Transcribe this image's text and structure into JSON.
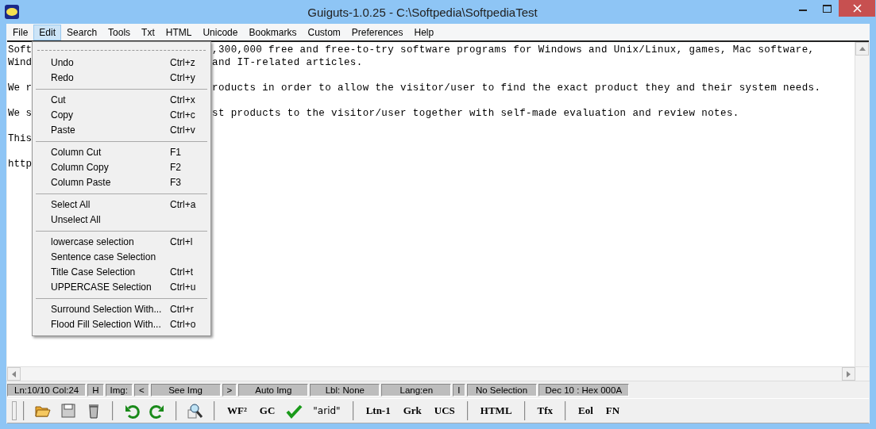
{
  "window": {
    "title": "Guiguts-1.0.25 - C:\\Softpedia\\SoftpediaTest"
  },
  "menu_bar": [
    {
      "label": "File",
      "selected": false
    },
    {
      "label": "Edit",
      "selected": true
    },
    {
      "label": "Search",
      "selected": false
    },
    {
      "label": "Tools",
      "selected": false
    },
    {
      "label": "Txt",
      "selected": false
    },
    {
      "label": "HTML",
      "selected": false
    },
    {
      "label": "Unicode",
      "selected": false
    },
    {
      "label": "Bookmarks",
      "selected": false
    },
    {
      "label": "Custom",
      "selected": false
    },
    {
      "label": "Preferences",
      "selected": false
    },
    {
      "label": "Help",
      "selected": false
    }
  ],
  "editor": {
    "paragraphs": [
      {
        "lines": [
          {
            "left": "Soft",
            "right": ",300,000 free and free-to-try software programs for Windows and Unix/Linux, games, Mac software,"
          },
          {
            "left": "Wind",
            "right": "and IT-related articles."
          }
        ]
      },
      {
        "lines": [
          {
            "left": "We r",
            "right": "roducts in order to allow the visitor/user to find the exact product they and their system needs."
          }
        ]
      },
      {
        "lines": [
          {
            "left": "We s",
            "right": "st products to the visitor/user together with self-made evaluation and review notes."
          }
        ]
      },
      {
        "lines": [
          {
            "left": "This"
          }
        ]
      },
      {
        "lines": [
          {
            "left": "http"
          }
        ]
      }
    ]
  },
  "edit_menu": {
    "groups": [
      [
        {
          "label": "Undo",
          "shortcut": "Ctrl+z"
        },
        {
          "label": "Redo",
          "shortcut": "Ctrl+y"
        }
      ],
      [
        {
          "label": "Cut",
          "shortcut": "Ctrl+x"
        },
        {
          "label": "Copy",
          "shortcut": "Ctrl+c"
        },
        {
          "label": "Paste",
          "shortcut": "Ctrl+v"
        }
      ],
      [
        {
          "label": "Column Cut",
          "shortcut": "F1"
        },
        {
          "label": "Column Copy",
          "shortcut": "F2"
        },
        {
          "label": "Column Paste",
          "shortcut": "F3"
        }
      ],
      [
        {
          "label": "Select All",
          "shortcut": "Ctrl+a"
        },
        {
          "label": "Unselect All"
        }
      ],
      [
        {
          "label": "lowercase selection",
          "shortcut": "Ctrl+l"
        },
        {
          "label": "Sentence case Selection"
        },
        {
          "label": "Title Case Selection",
          "shortcut": "Ctrl+t"
        },
        {
          "label": "UPPERCASE Selection",
          "shortcut": "Ctrl+u"
        }
      ],
      [
        {
          "label": "Surround Selection With...",
          "shortcut": "Ctrl+r"
        },
        {
          "label": "Flood Fill Selection With...",
          "shortcut": "Ctrl+o"
        }
      ]
    ]
  },
  "status_bar": [
    "Ln:10/10 Col:24",
    "H",
    "Img:",
    "<",
    "See Img",
    ">",
    "Auto Img",
    "Lbl: None",
    "Lang:en",
    "I",
    "No Selection",
    "Dec 10 : Hex 000A"
  ],
  "toolbar": {
    "groups": [
      [
        {
          "kind": "folder"
        },
        {
          "kind": "floppy"
        },
        {
          "kind": "trash"
        }
      ],
      [
        {
          "kind": "undo"
        },
        {
          "kind": "redo"
        }
      ],
      [
        {
          "kind": "magnifier"
        }
      ],
      [
        {
          "kind": "label",
          "label": "WF²"
        },
        {
          "kind": "label",
          "label": "GC"
        },
        {
          "kind": "check"
        },
        {
          "kind": "plain",
          "label": "\"arid\""
        }
      ],
      [
        {
          "kind": "label",
          "label": "Ltn-1"
        },
        {
          "kind": "label",
          "label": "Grk"
        },
        {
          "kind": "label",
          "label": "UCS"
        }
      ],
      [
        {
          "kind": "label",
          "label": "HTML"
        }
      ],
      [
        {
          "kind": "label",
          "label": "Tfx"
        }
      ],
      [
        {
          "kind": "label",
          "label": "Eol"
        },
        {
          "kind": "label",
          "label": "FN"
        }
      ]
    ]
  }
}
